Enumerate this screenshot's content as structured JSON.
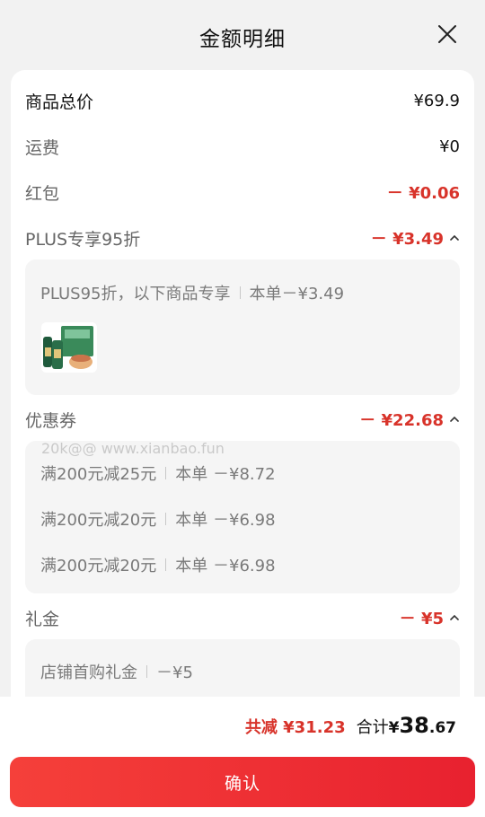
{
  "header": {
    "title": "金额明细"
  },
  "rows": {
    "goods_total": {
      "label": "商品总价",
      "value": "¥69.9"
    },
    "shipping": {
      "label": "运费",
      "value": "¥0"
    },
    "red_packet": {
      "label": "红包",
      "value": "－ ¥0.06"
    },
    "plus": {
      "label": "PLUS专享95折",
      "value": "－ ¥3.49"
    },
    "coupon": {
      "label": "优惠券",
      "value": "－ ¥22.68"
    },
    "gift": {
      "label": "礼金",
      "value": "－ ¥5"
    }
  },
  "plus_detail": {
    "desc": "PLUS95折，以下商品专享",
    "amount": "本单－¥3.49",
    "thumb_icon": "product-thumbnail-icon"
  },
  "coupon_detail": [
    {
      "name": "满200元减25元",
      "amount": "本单 －¥8.72"
    },
    {
      "name": "满200元减20元",
      "amount": "本单 －¥6.98"
    },
    {
      "name": "满200元减20元",
      "amount": "本单 －¥6.98"
    }
  ],
  "gift_detail": {
    "name": "店铺首购礼金",
    "amount": "－¥5"
  },
  "watermark": "20k@@ www.xianbao.fun",
  "footer": {
    "saved": "共减 ¥31.23",
    "total_label": "合计",
    "total_currency": "¥",
    "total_int": "38",
    "total_dec": ".67",
    "confirm_label": "确认"
  },
  "colors": {
    "accent": "#e8212f",
    "discount": "#d8332a"
  }
}
